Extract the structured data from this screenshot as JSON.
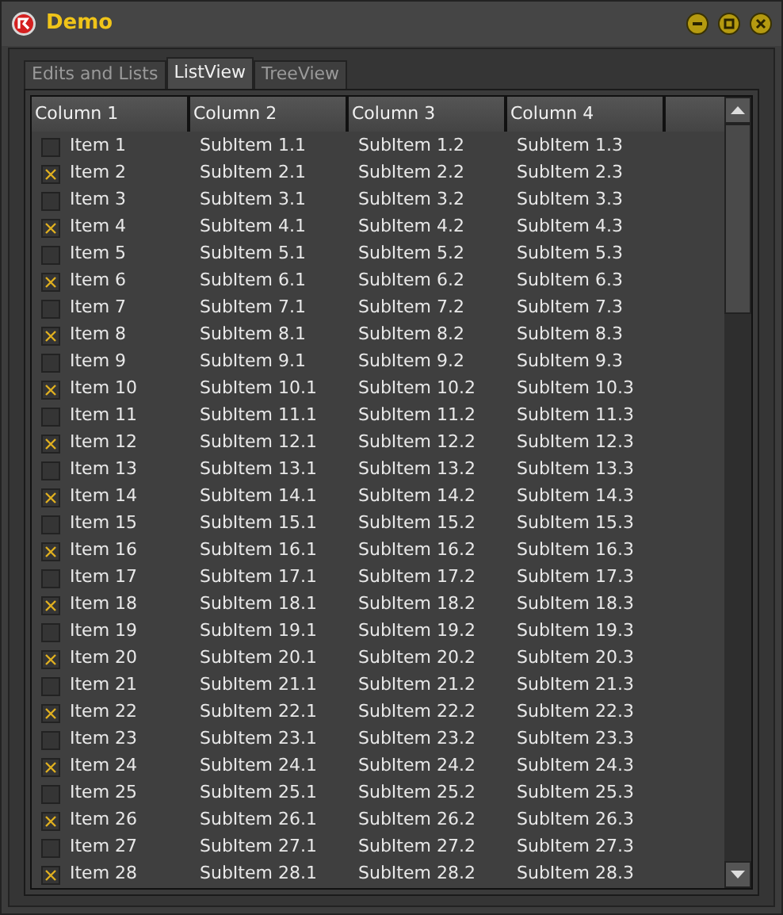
{
  "window": {
    "title": "Demo"
  },
  "tabs": [
    {
      "label": "Edits and Lists",
      "selected": false
    },
    {
      "label": "ListView",
      "selected": true
    },
    {
      "label": "TreeView",
      "selected": false
    }
  ],
  "list": {
    "columns": [
      "Column 1",
      "Column 2",
      "Column 3",
      "Column 4"
    ],
    "rows": [
      {
        "checked": false,
        "cells": [
          "Item 1",
          "SubItem 1.1",
          "SubItem 1.2",
          "SubItem 1.3"
        ]
      },
      {
        "checked": true,
        "cells": [
          "Item 2",
          "SubItem 2.1",
          "SubItem 2.2",
          "SubItem 2.3"
        ]
      },
      {
        "checked": false,
        "cells": [
          "Item 3",
          "SubItem 3.1",
          "SubItem 3.2",
          "SubItem 3.3"
        ]
      },
      {
        "checked": true,
        "cells": [
          "Item 4",
          "SubItem 4.1",
          "SubItem 4.2",
          "SubItem 4.3"
        ]
      },
      {
        "checked": false,
        "cells": [
          "Item 5",
          "SubItem 5.1",
          "SubItem 5.2",
          "SubItem 5.3"
        ]
      },
      {
        "checked": true,
        "cells": [
          "Item 6",
          "SubItem 6.1",
          "SubItem 6.2",
          "SubItem 6.3"
        ]
      },
      {
        "checked": false,
        "cells": [
          "Item 7",
          "SubItem 7.1",
          "SubItem 7.2",
          "SubItem 7.3"
        ]
      },
      {
        "checked": true,
        "cells": [
          "Item 8",
          "SubItem 8.1",
          "SubItem 8.2",
          "SubItem 8.3"
        ]
      },
      {
        "checked": false,
        "cells": [
          "Item 9",
          "SubItem 9.1",
          "SubItem 9.2",
          "SubItem 9.3"
        ]
      },
      {
        "checked": true,
        "cells": [
          "Item 10",
          "SubItem 10.1",
          "SubItem 10.2",
          "SubItem 10.3"
        ]
      },
      {
        "checked": false,
        "cells": [
          "Item 11",
          "SubItem 11.1",
          "SubItem 11.2",
          "SubItem 11.3"
        ]
      },
      {
        "checked": true,
        "cells": [
          "Item 12",
          "SubItem 12.1",
          "SubItem 12.2",
          "SubItem 12.3"
        ]
      },
      {
        "checked": false,
        "cells": [
          "Item 13",
          "SubItem 13.1",
          "SubItem 13.2",
          "SubItem 13.3"
        ]
      },
      {
        "checked": true,
        "cells": [
          "Item 14",
          "SubItem 14.1",
          "SubItem 14.2",
          "SubItem 14.3"
        ]
      },
      {
        "checked": false,
        "cells": [
          "Item 15",
          "SubItem 15.1",
          "SubItem 15.2",
          "SubItem 15.3"
        ]
      },
      {
        "checked": true,
        "cells": [
          "Item 16",
          "SubItem 16.1",
          "SubItem 16.2",
          "SubItem 16.3"
        ]
      },
      {
        "checked": false,
        "cells": [
          "Item 17",
          "SubItem 17.1",
          "SubItem 17.2",
          "SubItem 17.3"
        ]
      },
      {
        "checked": true,
        "cells": [
          "Item 18",
          "SubItem 18.1",
          "SubItem 18.2",
          "SubItem 18.3"
        ]
      },
      {
        "checked": false,
        "cells": [
          "Item 19",
          "SubItem 19.1",
          "SubItem 19.2",
          "SubItem 19.3"
        ]
      },
      {
        "checked": true,
        "cells": [
          "Item 20",
          "SubItem 20.1",
          "SubItem 20.2",
          "SubItem 20.3"
        ]
      },
      {
        "checked": false,
        "cells": [
          "Item 21",
          "SubItem 21.1",
          "SubItem 21.2",
          "SubItem 21.3"
        ]
      },
      {
        "checked": true,
        "cells": [
          "Item 22",
          "SubItem 22.1",
          "SubItem 22.2",
          "SubItem 22.3"
        ]
      },
      {
        "checked": false,
        "cells": [
          "Item 23",
          "SubItem 23.1",
          "SubItem 23.2",
          "SubItem 23.3"
        ]
      },
      {
        "checked": true,
        "cells": [
          "Item 24",
          "SubItem 24.1",
          "SubItem 24.2",
          "SubItem 24.3"
        ]
      },
      {
        "checked": false,
        "cells": [
          "Item 25",
          "SubItem 25.1",
          "SubItem 25.2",
          "SubItem 25.3"
        ]
      },
      {
        "checked": true,
        "cells": [
          "Item 26",
          "SubItem 26.1",
          "SubItem 26.2",
          "SubItem 26.3"
        ]
      },
      {
        "checked": false,
        "cells": [
          "Item 27",
          "SubItem 27.1",
          "SubItem 27.2",
          "SubItem 27.3"
        ]
      },
      {
        "checked": true,
        "cells": [
          "Item 28",
          "SubItem 28.1",
          "SubItem 28.2",
          "SubItem 28.3"
        ]
      }
    ]
  }
}
